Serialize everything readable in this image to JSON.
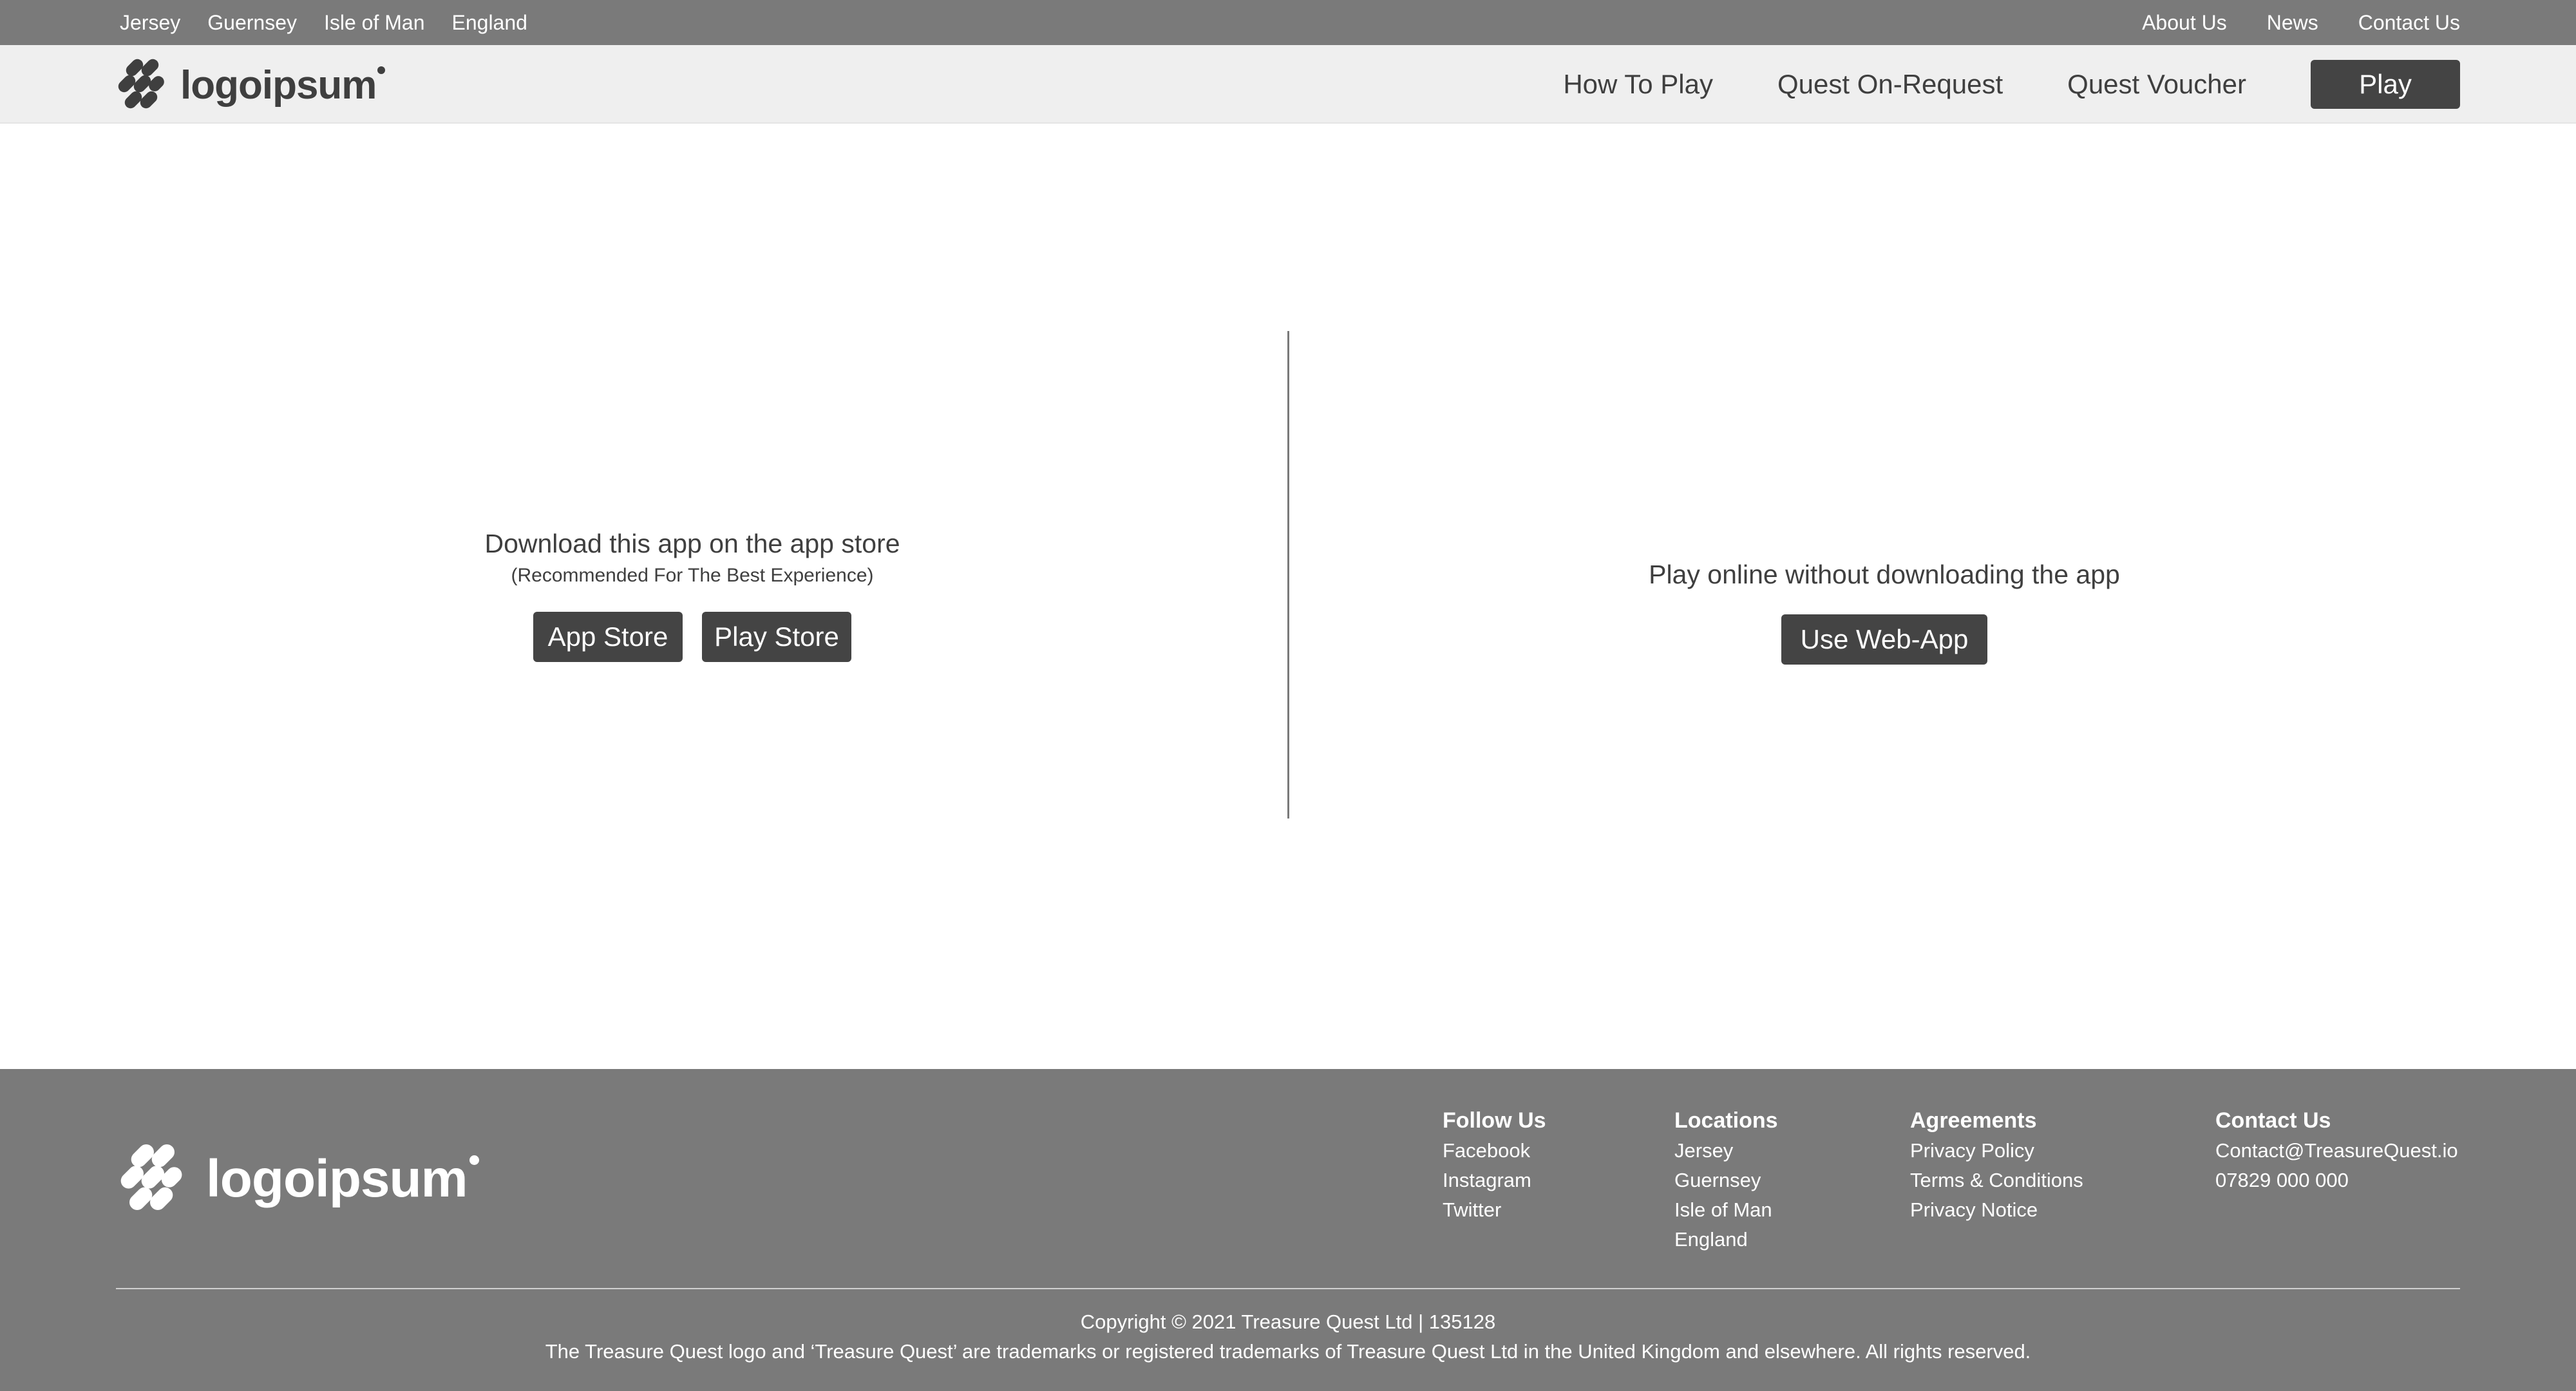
{
  "topbar": {
    "locations": [
      "Jersey",
      "Guernsey",
      "Isle of Man",
      "England"
    ],
    "links": [
      "About Us",
      "News",
      "Contact Us"
    ]
  },
  "header": {
    "logo_text": "logoipsum",
    "nav": [
      "How To Play",
      "Quest On-Request",
      "Quest Voucher"
    ],
    "play_label": "Play"
  },
  "download": {
    "heading": "Download this app on the app store",
    "subheading": "(Recommended For The Best Experience)",
    "app_store_label": "App Store",
    "play_store_label": "Play Store"
  },
  "online": {
    "heading": "Play online without downloading the app",
    "web_app_label": "Use Web-App"
  },
  "footer": {
    "logo_text": "logoipsum",
    "follow_us": {
      "title": "Follow Us",
      "items": [
        "Facebook",
        "Instagram",
        "Twitter"
      ]
    },
    "locations": {
      "title": "Locations",
      "items": [
        "Jersey",
        "Guernsey",
        "Isle of Man",
        "England"
      ]
    },
    "agreements": {
      "title": "Agreements",
      "items": [
        "Privacy Policy",
        "Terms & Conditions",
        "Privacy Notice"
      ]
    },
    "contact": {
      "title": "Contact Us",
      "items": [
        "Contact@TreasureQuest.io",
        "07829 000 000"
      ]
    },
    "copyright": "Copyright © 2021 Treasure Quest Ltd | 135128",
    "legal": "The Treasure Quest logo and ‘Treasure Quest’ are trademarks or registered trademarks of Treasure Quest Ltd in the United Kingdom and elsewhere. All rights reserved."
  },
  "colors": {
    "topbar_bg": "#7a7a7a",
    "header_bg": "#efefef",
    "button_bg": "#444444",
    "footer_bg": "#7a7a7a"
  }
}
